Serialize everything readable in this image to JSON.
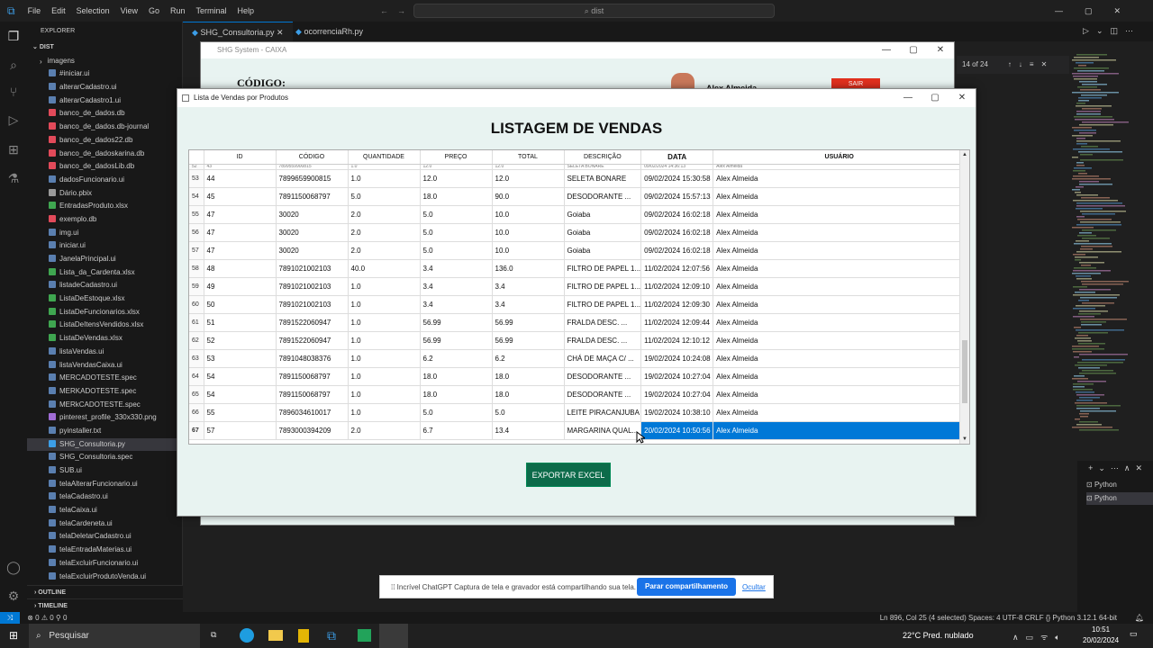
{
  "vscode": {
    "menu": [
      "File",
      "Edit",
      "Selection",
      "View",
      "Go",
      "Run",
      "Terminal",
      "Help"
    ],
    "search": "dist",
    "explorer_title": "EXPLORER",
    "root": "DIST",
    "files": [
      {
        "name": "imagens",
        "kind": "folder"
      },
      {
        "name": "#iniciar.ui",
        "kind": "ui"
      },
      {
        "name": "alterarCadastro.ui",
        "kind": "ui"
      },
      {
        "name": "alterarCadastro1.ui",
        "kind": "ui"
      },
      {
        "name": "banco_de_dados.db",
        "kind": "db"
      },
      {
        "name": "banco_de_dados.db-journal",
        "kind": "db"
      },
      {
        "name": "banco_de_dados22.db",
        "kind": "db"
      },
      {
        "name": "banco_de_dadoskarina.db",
        "kind": "db"
      },
      {
        "name": "banco_de_dadosLib.db",
        "kind": "db"
      },
      {
        "name": "dadosFuncionario.ui",
        "kind": "ui"
      },
      {
        "name": "Dário.pbix",
        "kind": "other"
      },
      {
        "name": "EntradasProduto.xlsx",
        "kind": "xlsx"
      },
      {
        "name": "exemplo.db",
        "kind": "db"
      },
      {
        "name": "img.ui",
        "kind": "ui"
      },
      {
        "name": "iniciar.ui",
        "kind": "ui"
      },
      {
        "name": "JanelaPrincipal.ui",
        "kind": "ui"
      },
      {
        "name": "Lista_da_Cardenta.xlsx",
        "kind": "xlsx"
      },
      {
        "name": "listadeCadastro.ui",
        "kind": "ui"
      },
      {
        "name": "ListaDeEstoque.xlsx",
        "kind": "xlsx"
      },
      {
        "name": "ListaDeFuncionarios.xlsx",
        "kind": "xlsx"
      },
      {
        "name": "ListaDeItensVendidos.xlsx",
        "kind": "xlsx"
      },
      {
        "name": "ListaDeVendas.xlsx",
        "kind": "xlsx"
      },
      {
        "name": "listaVendas.ui",
        "kind": "ui"
      },
      {
        "name": "listaVendasCaixa.ui",
        "kind": "ui"
      },
      {
        "name": "MERCADOTESTE.spec",
        "kind": "ui"
      },
      {
        "name": "MERKADOTESTE.spec",
        "kind": "ui"
      },
      {
        "name": "MERkCADOTESTE.spec",
        "kind": "ui"
      },
      {
        "name": "pinterest_profile_330x330.png",
        "kind": "img"
      },
      {
        "name": "pyinstaller.txt",
        "kind": "ui"
      },
      {
        "name": "SHG_Consultoria.py",
        "kind": "py",
        "selected": true
      },
      {
        "name": "SHG_Consultoria.spec",
        "kind": "ui"
      },
      {
        "name": "SUB.ui",
        "kind": "ui"
      },
      {
        "name": "telaAlterarFuncionario.ui",
        "kind": "ui"
      },
      {
        "name": "telaCadastro.ui",
        "kind": "ui"
      },
      {
        "name": "telaCaixa.ui",
        "kind": "ui"
      },
      {
        "name": "telaCardeneta.ui",
        "kind": "ui"
      },
      {
        "name": "telaDeletarCadastro.ui",
        "kind": "ui"
      },
      {
        "name": "telaEntradaMaterias.ui",
        "kind": "ui"
      },
      {
        "name": "telaExcluirFuncionario.ui",
        "kind": "ui"
      },
      {
        "name": "telaExcluirProdutoVenda.ui",
        "kind": "ui"
      }
    ],
    "outline": "OUTLINE",
    "timeline": "TIMELINE",
    "tabs": [
      "SHG_Consultoria.py",
      "ocorrenciaRh.py"
    ],
    "find_count": "14 of 24",
    "terminals": [
      "Python",
      "Python"
    ],
    "status_left": "⊗ 0 ⚠ 0   ⚲ 0",
    "status_right": "Ln 896, Col 25 (4 selected)   Spaces: 4   UTF-8   CRLF   {} Python   3.12.1 64-bit"
  },
  "back_window": {
    "title": "SHG System - CAIXA",
    "codigo_label": "CÓDIGO:",
    "user": "Alex Almeida",
    "sair": "SAIR"
  },
  "window": {
    "title": "Lista de Vendas por Produtos",
    "heading": "LISTAGEM DE VENDAS",
    "columns": [
      "ID",
      "CÓDIGO",
      "QUANTIDADE",
      "PREÇO",
      "TOTAL",
      "DESCRIÇÃO",
      "DATA",
      "USUÁRIO"
    ],
    "partial_row": [
      "52",
      "43",
      "7899559900815",
      "1.0",
      "12.0",
      "12.0",
      "SELETA BONARE",
      "09/02/2024 14:36:13",
      "Alex Almeida"
    ],
    "rows": [
      [
        "53",
        "44",
        "7899659900815",
        "1.0",
        "12.0",
        "12.0",
        "SELETA BONARE",
        "09/02/2024 15:30:58",
        "Alex Almeida"
      ],
      [
        "54",
        "45",
        "7891150068797",
        "5.0",
        "18.0",
        "90.0",
        "DESODORANTE ...",
        "09/02/2024 15:57:13",
        "Alex Almeida"
      ],
      [
        "55",
        "47",
        "30020",
        "2.0",
        "5.0",
        "10.0",
        "Goiaba",
        "09/02/2024 16:02:18",
        "Alex Almeida"
      ],
      [
        "56",
        "47",
        "30020",
        "2.0",
        "5.0",
        "10.0",
        "Goiaba",
        "09/02/2024 16:02:18",
        "Alex Almeida"
      ],
      [
        "57",
        "47",
        "30020",
        "2.0",
        "5.0",
        "10.0",
        "Goiaba",
        "09/02/2024 16:02:18",
        "Alex Almeida"
      ],
      [
        "58",
        "48",
        "7891021002103",
        "40.0",
        "3.4",
        "136.0",
        "FILTRO DE PAPEL 1...",
        "11/02/2024 12:07:56",
        "Alex Almeida"
      ],
      [
        "59",
        "49",
        "7891021002103",
        "1.0",
        "3.4",
        "3.4",
        "FILTRO DE PAPEL 1...",
        "11/02/2024 12:09:10",
        "Alex Almeida"
      ],
      [
        "60",
        "50",
        "7891021002103",
        "1.0",
        "3.4",
        "3.4",
        "FILTRO DE PAPEL 1...",
        "11/02/2024 12:09:30",
        "Alex Almeida"
      ],
      [
        "61",
        "51",
        "7891522060947",
        "1.0",
        "56.99",
        "56.99",
        "FRALDA DESC. ...",
        "11/02/2024 12:09:44",
        "Alex Almeida"
      ],
      [
        "62",
        "52",
        "7891522060947",
        "1.0",
        "56.99",
        "56.99",
        "FRALDA DESC. ...",
        "11/02/2024 12:10:12",
        "Alex Almeida"
      ],
      [
        "63",
        "53",
        "7891048038376",
        "1.0",
        "6.2",
        "6.2",
        "CHÁ DE MAÇA C/ ...",
        "19/02/2024 10:24:08",
        "Alex Almeida"
      ],
      [
        "64",
        "54",
        "7891150068797",
        "1.0",
        "18.0",
        "18.0",
        "DESODORANTE ...",
        "19/02/2024 10:27:04",
        "Alex Almeida"
      ],
      [
        "65",
        "54",
        "7891150068797",
        "1.0",
        "18.0",
        "18.0",
        "DESODORANTE ...",
        "19/02/2024 10:27:04",
        "Alex Almeida"
      ],
      [
        "66",
        "55",
        "7896034610017",
        "1.0",
        "5.0",
        "5.0",
        "LEITE PIRACANJUBA",
        "19/02/2024 10:38:10",
        "Alex Almeida"
      ],
      [
        "67",
        "57",
        "7893000394209",
        "2.0",
        "6.7",
        "13.4",
        "MARGARINA QUAL...",
        "20/02/2024 10:50:56",
        "Alex Almeida"
      ]
    ],
    "selected_row": "67",
    "export_button": "EXPORTAR EXCEL",
    "scroll_position": 0.85
  },
  "notification": {
    "text": "⁞⁞  Incrível ChatGPT Captura de tela e gravador está compartilhando sua tela.",
    "stop_button": "Parar compartilhamento",
    "hide_link": "Ocultar"
  },
  "taskbar": {
    "search": "Pesquisar",
    "weather": "22°C  Pred. nublado",
    "time": "10:51",
    "date": "20/02/2024"
  }
}
